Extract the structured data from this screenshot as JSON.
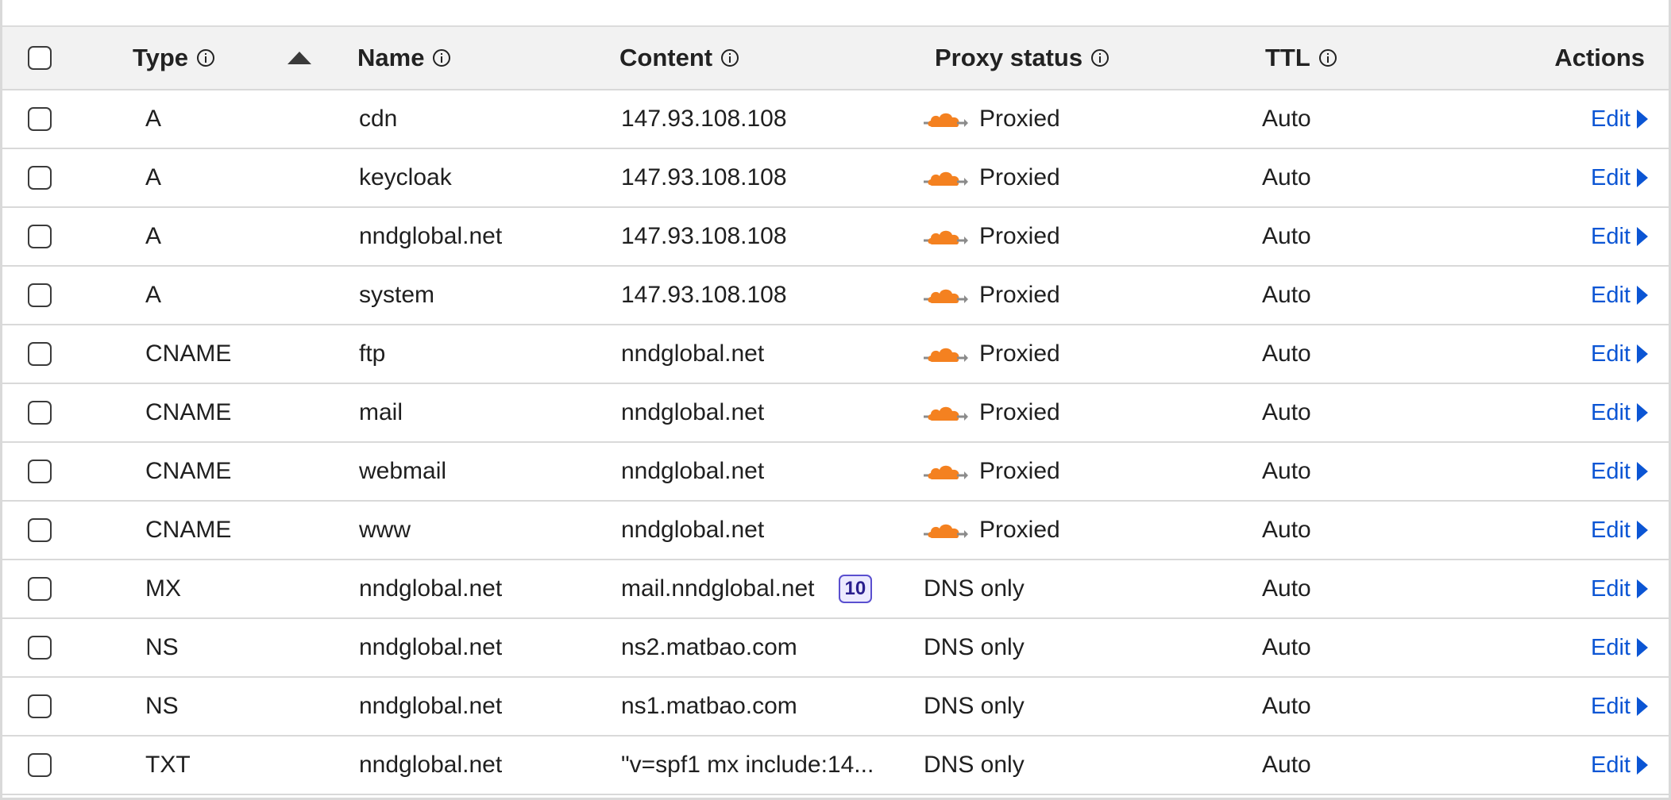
{
  "header": {
    "type": "Type",
    "name": "Name",
    "content": "Content",
    "proxy_status": "Proxy status",
    "ttl": "TTL",
    "actions": "Actions"
  },
  "colors": {
    "accent_link": "#0b55d4",
    "cloud_orange": "#f48120",
    "priority_border": "#5a4fcf"
  },
  "icons": {
    "info": "info-circle-icon",
    "sort": "sort-ascending-icon",
    "proxied": "cloudflare-proxied-cloud-icon",
    "edit": "caret-right-icon"
  },
  "records": [
    {
      "type": "A",
      "name": "cdn",
      "content": "147.93.108.108",
      "proxy": "Proxied",
      "ttl": "Auto",
      "action": "Edit"
    },
    {
      "type": "A",
      "name": "keycloak",
      "content": "147.93.108.108",
      "proxy": "Proxied",
      "ttl": "Auto",
      "action": "Edit"
    },
    {
      "type": "A",
      "name": "nndglobal.net",
      "content": "147.93.108.108",
      "proxy": "Proxied",
      "ttl": "Auto",
      "action": "Edit"
    },
    {
      "type": "A",
      "name": "system",
      "content": "147.93.108.108",
      "proxy": "Proxied",
      "ttl": "Auto",
      "action": "Edit"
    },
    {
      "type": "CNAME",
      "name": "ftp",
      "content": "nndglobal.net",
      "proxy": "Proxied",
      "ttl": "Auto",
      "action": "Edit"
    },
    {
      "type": "CNAME",
      "name": "mail",
      "content": "nndglobal.net",
      "proxy": "Proxied",
      "ttl": "Auto",
      "action": "Edit"
    },
    {
      "type": "CNAME",
      "name": "webmail",
      "content": "nndglobal.net",
      "proxy": "Proxied",
      "ttl": "Auto",
      "action": "Edit"
    },
    {
      "type": "CNAME",
      "name": "www",
      "content": "nndglobal.net",
      "proxy": "Proxied",
      "ttl": "Auto",
      "action": "Edit"
    },
    {
      "type": "MX",
      "name": "nndglobal.net",
      "content": "mail.nndglobal.net",
      "priority": "10",
      "proxy": "DNS only",
      "ttl": "Auto",
      "action": "Edit"
    },
    {
      "type": "NS",
      "name": "nndglobal.net",
      "content": "ns2.matbao.com",
      "proxy": "DNS only",
      "ttl": "Auto",
      "action": "Edit"
    },
    {
      "type": "NS",
      "name": "nndglobal.net",
      "content": "ns1.matbao.com",
      "proxy": "DNS only",
      "ttl": "Auto",
      "action": "Edit"
    },
    {
      "type": "TXT",
      "name": "nndglobal.net",
      "content": "\"v=spf1 mx include:14...",
      "proxy": "DNS only",
      "ttl": "Auto",
      "action": "Edit"
    }
  ]
}
